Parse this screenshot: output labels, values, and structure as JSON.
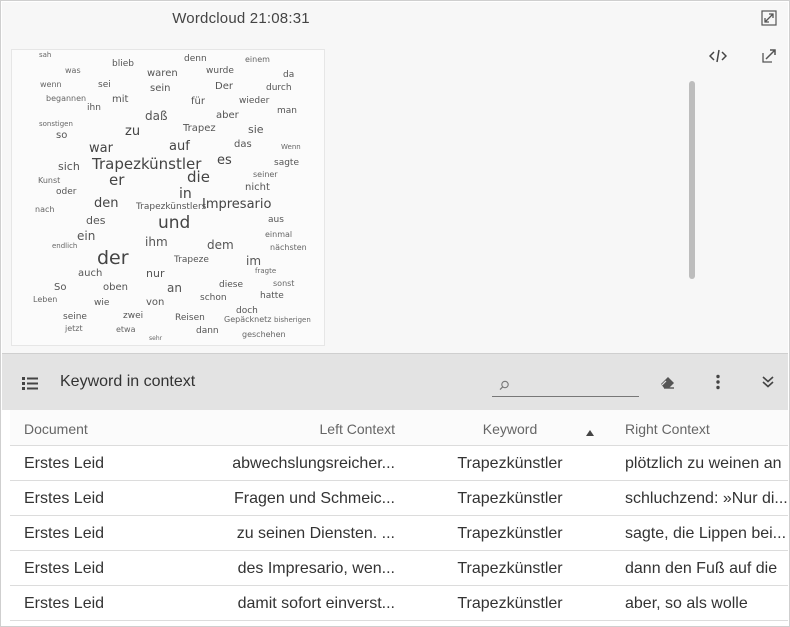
{
  "wordcloud": {
    "title": "Wordcloud 21:08:31",
    "words": [
      {
        "text": "sah",
        "size": 7
      },
      {
        "text": "blieb",
        "size": 9
      },
      {
        "text": "denn",
        "size": 9
      },
      {
        "text": "einem",
        "size": 8
      },
      {
        "text": "was",
        "size": 8
      },
      {
        "text": "waren",
        "size": 10
      },
      {
        "text": "wurde",
        "size": 9
      },
      {
        "text": "da",
        "size": 9
      },
      {
        "text": "wenn",
        "size": 8
      },
      {
        "text": "sei",
        "size": 9
      },
      {
        "text": "sein",
        "size": 10
      },
      {
        "text": "Der",
        "size": 10
      },
      {
        "text": "durch",
        "size": 9
      },
      {
        "text": "begannen",
        "size": 8
      },
      {
        "text": "mit",
        "size": 10
      },
      {
        "text": "für",
        "size": 10
      },
      {
        "text": "wieder",
        "size": 9
      },
      {
        "text": "ihn",
        "size": 9
      },
      {
        "text": "daß",
        "size": 12
      },
      {
        "text": "aber",
        "size": 10
      },
      {
        "text": "man",
        "size": 9
      },
      {
        "text": "sonstigen",
        "size": 7
      },
      {
        "text": "zu",
        "size": 13
      },
      {
        "text": "Trapez",
        "size": 10
      },
      {
        "text": "sie",
        "size": 11
      },
      {
        "text": "so",
        "size": 10
      },
      {
        "text": "war",
        "size": 13
      },
      {
        "text": "auf",
        "size": 13
      },
      {
        "text": "das",
        "size": 10
      },
      {
        "text": "Wenn",
        "size": 7
      },
      {
        "text": "sich",
        "size": 11
      },
      {
        "text": "Trapezkünstler",
        "size": 15
      },
      {
        "text": "es",
        "size": 13
      },
      {
        "text": "sagte",
        "size": 9
      },
      {
        "text": "Kunst",
        "size": 8
      },
      {
        "text": "er",
        "size": 15
      },
      {
        "text": "die",
        "size": 15
      },
      {
        "text": "seiner",
        "size": 8
      },
      {
        "text": "oder",
        "size": 9
      },
      {
        "text": "in",
        "size": 14
      },
      {
        "text": "nicht",
        "size": 10
      },
      {
        "text": "nach",
        "size": 8
      },
      {
        "text": "den",
        "size": 13
      },
      {
        "text": "Trapezkünstlers",
        "size": 9
      },
      {
        "text": "Impresario",
        "size": 13
      },
      {
        "text": "des",
        "size": 11
      },
      {
        "text": "und",
        "size": 17
      },
      {
        "text": "aus",
        "size": 9
      },
      {
        "text": "ein",
        "size": 12
      },
      {
        "text": "einmal",
        "size": 8
      },
      {
        "text": "endlich",
        "size": 7
      },
      {
        "text": "ihm",
        "size": 12
      },
      {
        "text": "dem",
        "size": 12
      },
      {
        "text": "nächsten",
        "size": 8
      },
      {
        "text": "der",
        "size": 19
      },
      {
        "text": "Trapeze",
        "size": 9
      },
      {
        "text": "im",
        "size": 12
      },
      {
        "text": "auch",
        "size": 10
      },
      {
        "text": "nur",
        "size": 11
      },
      {
        "text": "fragte",
        "size": 7
      },
      {
        "text": "So",
        "size": 10
      },
      {
        "text": "oben",
        "size": 10
      },
      {
        "text": "an",
        "size": 12
      },
      {
        "text": "diese",
        "size": 9
      },
      {
        "text": "sonst",
        "size": 8
      },
      {
        "text": "Leben",
        "size": 8
      },
      {
        "text": "wie",
        "size": 9
      },
      {
        "text": "von",
        "size": 10
      },
      {
        "text": "schon",
        "size": 9
      },
      {
        "text": "hatte",
        "size": 9
      },
      {
        "text": "seine",
        "size": 9
      },
      {
        "text": "zwei",
        "size": 9
      },
      {
        "text": "doch",
        "size": 9
      },
      {
        "text": "Reisen",
        "size": 9
      },
      {
        "text": "Gepäcknetz",
        "size": 8
      },
      {
        "text": "bisherigen",
        "size": 7
      },
      {
        "text": "jetzt",
        "size": 8
      },
      {
        "text": "etwa",
        "size": 8
      },
      {
        "text": "dann",
        "size": 9
      },
      {
        "text": "geschehen",
        "size": 8
      },
      {
        "text": "sehr",
        "size": 6
      }
    ]
  },
  "kwic": {
    "title": "Keyword in context",
    "search_placeholder": "",
    "columns": {
      "document": "Document",
      "left": "Left Context",
      "keyword": "Keyword",
      "right": "Right Context"
    },
    "rows": [
      {
        "document": "Erstes Leid",
        "left": "abwechslungsreicher...",
        "keyword": "Trapezkünstler",
        "right": "plötzlich zu weinen an"
      },
      {
        "document": "Erstes Leid",
        "left": "Fragen und Schmeic...",
        "keyword": "Trapezkünstler",
        "right": "schluchzend: »Nur di..."
      },
      {
        "document": "Erstes Leid",
        "left": "zu seinen Diensten. ...",
        "keyword": "Trapezkünstler",
        "right": "sagte, die Lippen bei..."
      },
      {
        "document": "Erstes Leid",
        "left": "des Impresario, wen...",
        "keyword": "Trapezkünstler",
        "right": "dann den Fuß auf die"
      },
      {
        "document": "Erstes Leid",
        "left": "damit sofort einverst...",
        "keyword": "Trapezkünstler",
        "right": "aber, so als wolle"
      }
    ]
  }
}
